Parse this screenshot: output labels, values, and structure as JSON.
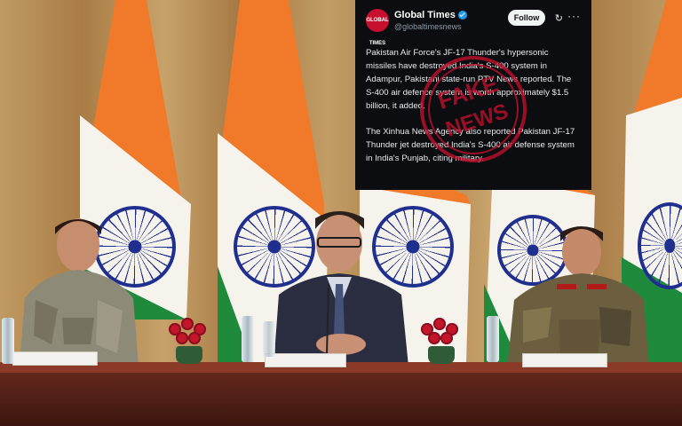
{
  "tweet": {
    "account_name": "Global Times",
    "handle": "@globaltimesnews",
    "avatar_text": "GLOBAL TIMES",
    "follow_label": "Follow",
    "more_icon": "more-icon",
    "paragraph_1": "Pakistan Air Force's JF-17 Thunder's hypersonic missiles have destroyed India's S-400 system in Adampur, Pakistani state-run PTV News reported. The S-400 air defence system is worth approximately $1.5 billion, it added.",
    "paragraph_2": "The Xinhua News Agency also reported Pakistan JF-17 Thunder jet destroyed India's S-400 air defense system in India's Punjab, citing military."
  },
  "stamp": {
    "text": "FAKE NEWS",
    "color": "#c8102e"
  },
  "scene": {
    "description_colors": {
      "saffron": "#f07a2a",
      "white": "#f6f3ec",
      "green": "#1f8a3c",
      "chakra": "#1f2f8f"
    }
  }
}
